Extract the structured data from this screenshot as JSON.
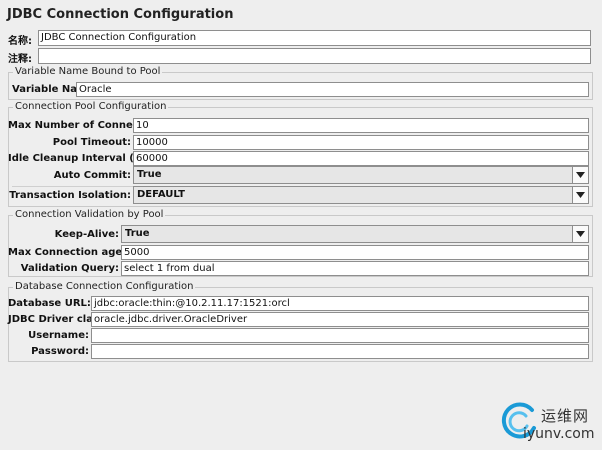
{
  "title": "JDBC Connection Configuration",
  "name_row": {
    "label": "名称:",
    "value": "JDBC Connection Configuration"
  },
  "comment_row": {
    "label": "注释:",
    "value": ""
  },
  "variable_group": {
    "legend": "Variable Name Bound to Pool",
    "label": "Variable Name:",
    "value": "Oracle"
  },
  "pool_group": {
    "legend": "Connection Pool Configuration",
    "max_connections": {
      "label": "Max Number of Connections:",
      "value": "10"
    },
    "pool_timeout": {
      "label": "Pool Timeout:",
      "value": "10000"
    },
    "idle_cleanup": {
      "label": "Idle Cleanup Interval (ms):",
      "value": "60000"
    },
    "auto_commit": {
      "label": "Auto Commit:",
      "value": "True"
    },
    "transaction_isolation": {
      "label": "Transaction Isolation:",
      "value": "DEFAULT"
    }
  },
  "validation_group": {
    "legend": "Connection Validation by Pool",
    "keep_alive": {
      "label": "Keep-Alive:",
      "value": "True"
    },
    "max_age": {
      "label": "Max Connection age (ms):",
      "value": "5000"
    },
    "validation_query": {
      "label": "Validation Query:",
      "value": "select 1 from dual"
    }
  },
  "database_group": {
    "legend": "Database Connection Configuration",
    "database_url": {
      "label": "Database URL:",
      "value": "jdbc:oracle:thin:@10.2.11.17:1521:orcl"
    },
    "driver_class": {
      "label": "JDBC Driver class:",
      "value": "oracle.jdbc.driver.OracleDriver"
    },
    "username": {
      "label": "Username:",
      "value": ""
    },
    "password": {
      "label": "Password:",
      "value": ""
    }
  },
  "watermark": {
    "cn": "运维网",
    "en": "iyunv.com"
  },
  "icons": {
    "dropdown": "chevron-down-icon",
    "logo": "swirl-logo-icon"
  },
  "colors": {
    "background": "#eeeeee",
    "field": "#ffffff",
    "border": "#8e8e8e",
    "logo": "#1a9ad6"
  }
}
